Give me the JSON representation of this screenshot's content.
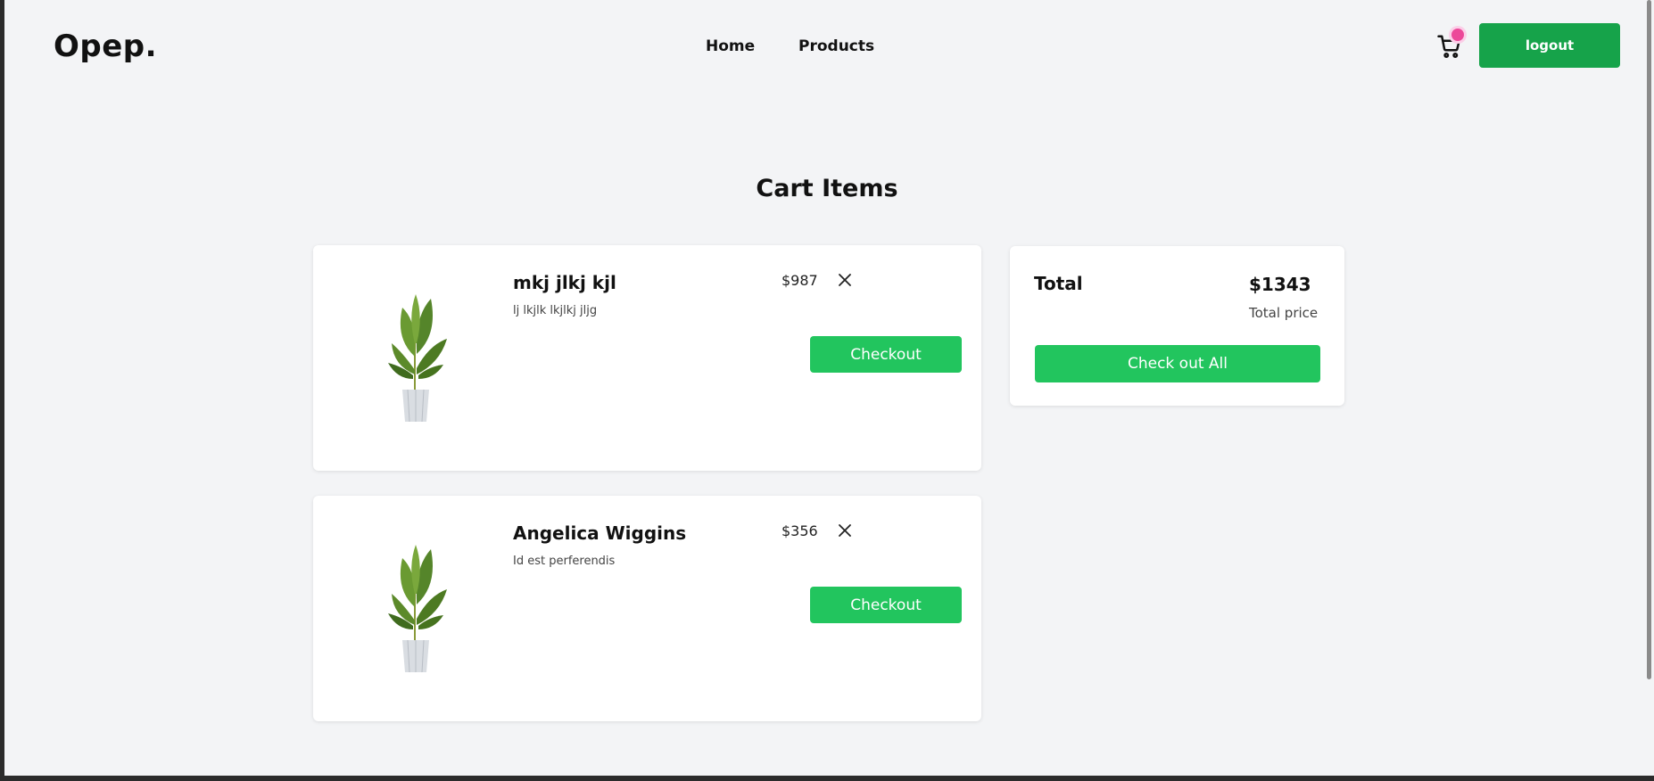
{
  "nav": {
    "logo": "Opep.",
    "home_label": "Home",
    "products_label": "Products",
    "cart_icon": "cart-icon",
    "logout_label": "logout"
  },
  "page": {
    "title": "Cart Items"
  },
  "cart": {
    "items": [
      {
        "name": "mkj jlkj kjl",
        "description": "lj lkjlk lkjlkj jljg",
        "price": "$987",
        "checkout_label": "Checkout"
      },
      {
        "name": "Angelica Wiggins",
        "description": "Id est perferendis",
        "price": "$356",
        "checkout_label": "Checkout"
      }
    ]
  },
  "summary": {
    "label": "Total",
    "amount": "$1343",
    "sub_label": "Total price",
    "checkout_all_label": "Check out All"
  },
  "colors": {
    "accent": "#22c55e",
    "logout_bg": "#16a34a",
    "cart_badge": "#ec4899",
    "background": "#f3f4f6"
  }
}
